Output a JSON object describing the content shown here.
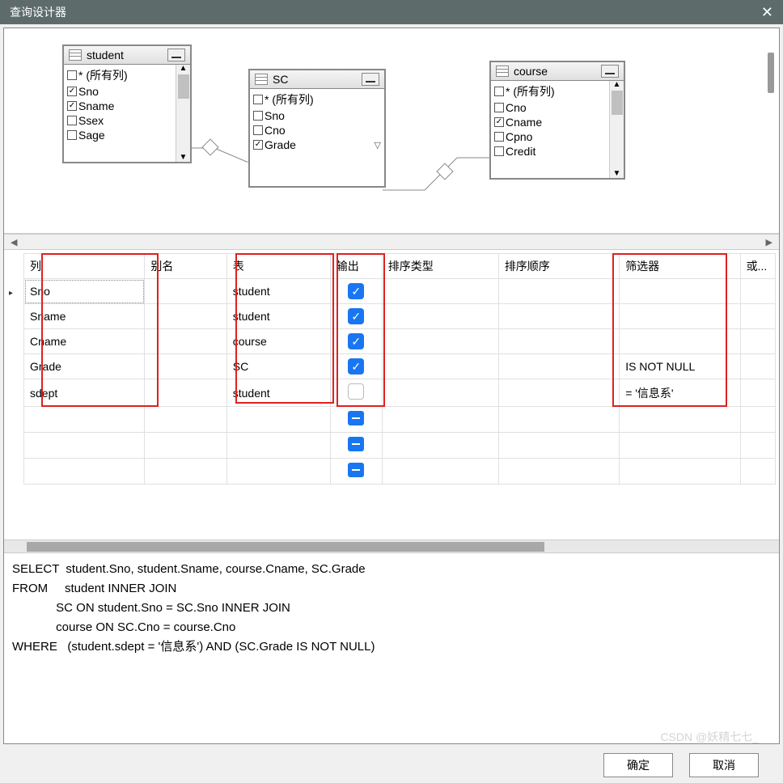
{
  "window": {
    "title": "查询设计器"
  },
  "tables": {
    "student": {
      "name": "student",
      "cols": [
        {
          "label": "* (所有列)",
          "checked": false
        },
        {
          "label": "Sno",
          "checked": true
        },
        {
          "label": "Sname",
          "checked": true
        },
        {
          "label": "Ssex",
          "checked": false
        },
        {
          "label": "Sage",
          "checked": false
        }
      ]
    },
    "sc": {
      "name": "SC",
      "cols": [
        {
          "label": "* (所有列)",
          "checked": false
        },
        {
          "label": "Sno",
          "checked": false
        },
        {
          "label": "Cno",
          "checked": false
        },
        {
          "label": "Grade",
          "checked": true,
          "filter": true
        }
      ]
    },
    "course": {
      "name": "course",
      "cols": [
        {
          "label": "* (所有列)",
          "checked": false
        },
        {
          "label": "Cno",
          "checked": false
        },
        {
          "label": "Cname",
          "checked": true
        },
        {
          "label": "Cpno",
          "checked": false
        },
        {
          "label": "Credit",
          "checked": false
        }
      ]
    }
  },
  "grid": {
    "headers": {
      "col": "列",
      "alias": "别名",
      "table": "表",
      "output": "输出",
      "sorttype": "排序类型",
      "sortorder": "排序顺序",
      "filter": "筛选器",
      "or": "或..."
    },
    "rows": [
      {
        "col": "Sno",
        "table": "student",
        "output": true,
        "filter": ""
      },
      {
        "col": "Sname",
        "table": "student",
        "output": true,
        "filter": ""
      },
      {
        "col": "Cname",
        "table": "course",
        "output": true,
        "filter": ""
      },
      {
        "col": "Grade",
        "table": "SC",
        "output": true,
        "filter": "IS NOT NULL"
      },
      {
        "col": "sdept",
        "table": "student",
        "output": false,
        "filter": "= '信息系'"
      }
    ]
  },
  "sql": "SELECT  student.Sno, student.Sname, course.Cname, SC.Grade\nFROM     student INNER JOIN\n             SC ON student.Sno = SC.Sno INNER JOIN\n             course ON SC.Cno = course.Cno\nWHERE   (student.sdept = '信息系') AND (SC.Grade IS NOT NULL)",
  "buttons": {
    "ok": "确定",
    "cancel": "取消"
  },
  "watermark": "CSDN @妖精七七_"
}
